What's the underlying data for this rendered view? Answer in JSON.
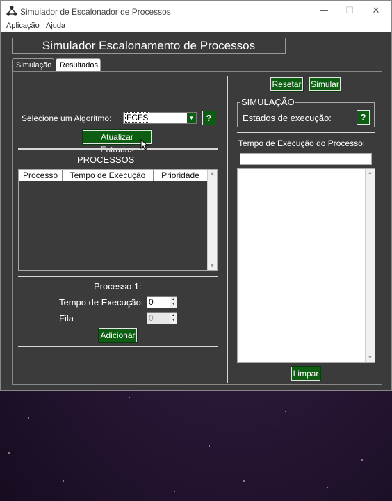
{
  "window": {
    "title": "Simulador de Escalonador de Processos",
    "minimize": "—",
    "maximize": "☐",
    "close": "✕"
  },
  "menu": [
    "Aplicação",
    "Ajuda"
  ],
  "app_title": "Simulador Escalonamento de Processos",
  "tabs": [
    {
      "label": "Simulação",
      "active": true
    },
    {
      "label": "Resultados",
      "active": false
    }
  ],
  "left": {
    "algorithm_label": "Selecione um Algoritmo:",
    "algorithm_value": "FCFS",
    "help_label": "?",
    "update_button": "Atualizar Entradas",
    "processes_heading": "PROCESSOS",
    "table_columns": [
      "Processo",
      "Tempo de Execução",
      "Prioridade"
    ],
    "table_rows": [],
    "process_heading": "Processo 1:",
    "exec_time_label": "Tempo de Execução:",
    "exec_time_value": "0",
    "queue_label": "Fila",
    "queue_value": "0",
    "add_button": "Adicionar"
  },
  "right": {
    "reset_button": "Resetar",
    "simulate_button": "Simular",
    "simulation_group": "SIMULAÇÃO",
    "states_label": "Estados de execução:",
    "help_label": "?",
    "exec_time_heading": "Tempo de Execução do Processo:",
    "exec_time_value": "",
    "clear_button": "Limpar"
  },
  "colors": {
    "panel_bg": "#3b3b3b",
    "button_green": "#0d5e12",
    "desktop": "#2a1838"
  },
  "icons": {
    "app": "process-scheduler-icon",
    "cursor": "mouse-pointer-icon",
    "help": "question-mark-icon"
  }
}
